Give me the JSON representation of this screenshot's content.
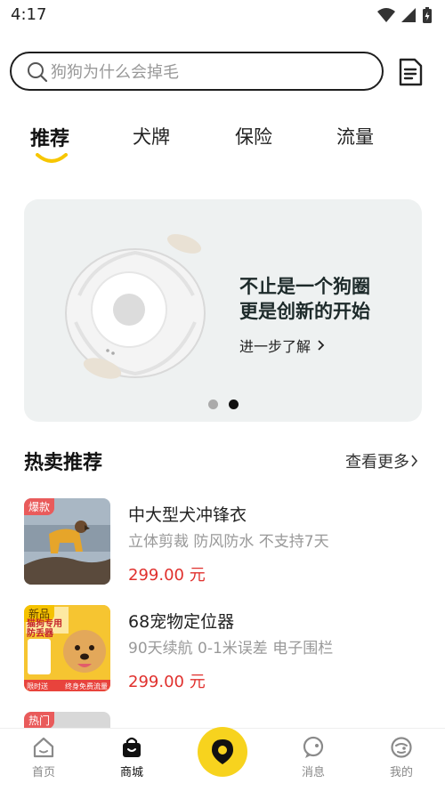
{
  "status_bar": {
    "time": "4:17"
  },
  "search": {
    "placeholder": "狗狗为什么会掉毛"
  },
  "tabs": [
    {
      "label": "推荐",
      "active": true
    },
    {
      "label": "犬牌",
      "active": false
    },
    {
      "label": "保险",
      "active": false
    },
    {
      "label": "流量",
      "active": false
    }
  ],
  "banner": {
    "title_line1": "不止是一个狗圈",
    "title_line2": "更是创新的开始",
    "link_label": "进一步了解",
    "dots_total": 2,
    "active_dot": 2
  },
  "section": {
    "title": "热卖推荐",
    "more_label": "查看更多"
  },
  "products": [
    {
      "badge": "爆款",
      "name": "中大型犬冲锋衣",
      "desc": "立体剪裁 防风防水 不支持7天",
      "price": "299.00 元"
    },
    {
      "badge": "新品",
      "name": "68宠物定位器",
      "desc": "90天续航 0-1米误差 电子围栏",
      "price": "299.00 元",
      "thumb_title_1": "猫狗专用",
      "thumb_title_2": "防丢器",
      "thumb_left_tag": "限时送",
      "thumb_right_tag": "终身免费流量"
    },
    {
      "badge": "热门"
    }
  ],
  "tabbar": [
    {
      "label": "首页",
      "icon": "home-icon"
    },
    {
      "label": "商城",
      "icon": "shop-bag-icon",
      "active": true
    },
    {
      "label": "",
      "icon": "location-pin-icon"
    },
    {
      "label": "消息",
      "icon": "message-icon"
    },
    {
      "label": "我的",
      "icon": "profile-icon"
    }
  ],
  "colors": {
    "accent": "#f7d31e",
    "price": "#e0302d",
    "badge": "#e95b5b"
  }
}
